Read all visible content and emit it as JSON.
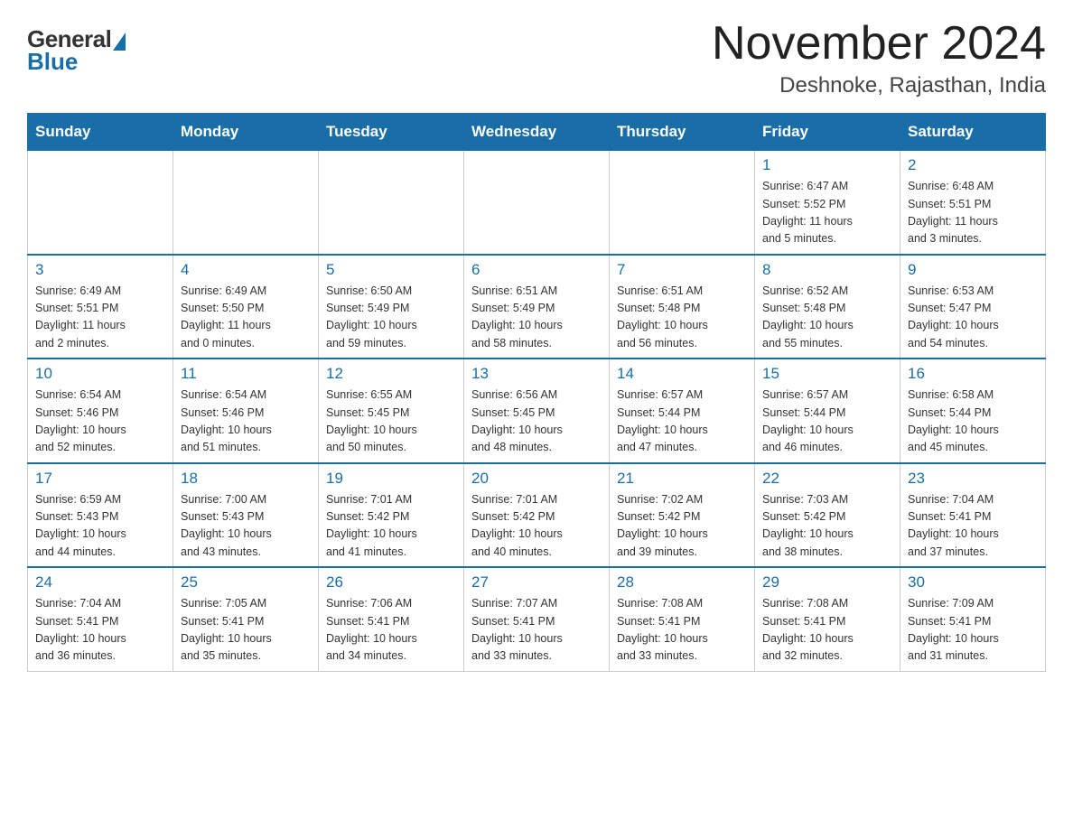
{
  "header": {
    "logo_general": "General",
    "logo_blue": "Blue",
    "month_title": "November 2024",
    "location": "Deshnoke, Rajasthan, India"
  },
  "weekdays": [
    "Sunday",
    "Monday",
    "Tuesday",
    "Wednesday",
    "Thursday",
    "Friday",
    "Saturday"
  ],
  "weeks": [
    [
      {
        "day": "",
        "info": ""
      },
      {
        "day": "",
        "info": ""
      },
      {
        "day": "",
        "info": ""
      },
      {
        "day": "",
        "info": ""
      },
      {
        "day": "",
        "info": ""
      },
      {
        "day": "1",
        "info": "Sunrise: 6:47 AM\nSunset: 5:52 PM\nDaylight: 11 hours\nand 5 minutes."
      },
      {
        "day": "2",
        "info": "Sunrise: 6:48 AM\nSunset: 5:51 PM\nDaylight: 11 hours\nand 3 minutes."
      }
    ],
    [
      {
        "day": "3",
        "info": "Sunrise: 6:49 AM\nSunset: 5:51 PM\nDaylight: 11 hours\nand 2 minutes."
      },
      {
        "day": "4",
        "info": "Sunrise: 6:49 AM\nSunset: 5:50 PM\nDaylight: 11 hours\nand 0 minutes."
      },
      {
        "day": "5",
        "info": "Sunrise: 6:50 AM\nSunset: 5:49 PM\nDaylight: 10 hours\nand 59 minutes."
      },
      {
        "day": "6",
        "info": "Sunrise: 6:51 AM\nSunset: 5:49 PM\nDaylight: 10 hours\nand 58 minutes."
      },
      {
        "day": "7",
        "info": "Sunrise: 6:51 AM\nSunset: 5:48 PM\nDaylight: 10 hours\nand 56 minutes."
      },
      {
        "day": "8",
        "info": "Sunrise: 6:52 AM\nSunset: 5:48 PM\nDaylight: 10 hours\nand 55 minutes."
      },
      {
        "day": "9",
        "info": "Sunrise: 6:53 AM\nSunset: 5:47 PM\nDaylight: 10 hours\nand 54 minutes."
      }
    ],
    [
      {
        "day": "10",
        "info": "Sunrise: 6:54 AM\nSunset: 5:46 PM\nDaylight: 10 hours\nand 52 minutes."
      },
      {
        "day": "11",
        "info": "Sunrise: 6:54 AM\nSunset: 5:46 PM\nDaylight: 10 hours\nand 51 minutes."
      },
      {
        "day": "12",
        "info": "Sunrise: 6:55 AM\nSunset: 5:45 PM\nDaylight: 10 hours\nand 50 minutes."
      },
      {
        "day": "13",
        "info": "Sunrise: 6:56 AM\nSunset: 5:45 PM\nDaylight: 10 hours\nand 48 minutes."
      },
      {
        "day": "14",
        "info": "Sunrise: 6:57 AM\nSunset: 5:44 PM\nDaylight: 10 hours\nand 47 minutes."
      },
      {
        "day": "15",
        "info": "Sunrise: 6:57 AM\nSunset: 5:44 PM\nDaylight: 10 hours\nand 46 minutes."
      },
      {
        "day": "16",
        "info": "Sunrise: 6:58 AM\nSunset: 5:44 PM\nDaylight: 10 hours\nand 45 minutes."
      }
    ],
    [
      {
        "day": "17",
        "info": "Sunrise: 6:59 AM\nSunset: 5:43 PM\nDaylight: 10 hours\nand 44 minutes."
      },
      {
        "day": "18",
        "info": "Sunrise: 7:00 AM\nSunset: 5:43 PM\nDaylight: 10 hours\nand 43 minutes."
      },
      {
        "day": "19",
        "info": "Sunrise: 7:01 AM\nSunset: 5:42 PM\nDaylight: 10 hours\nand 41 minutes."
      },
      {
        "day": "20",
        "info": "Sunrise: 7:01 AM\nSunset: 5:42 PM\nDaylight: 10 hours\nand 40 minutes."
      },
      {
        "day": "21",
        "info": "Sunrise: 7:02 AM\nSunset: 5:42 PM\nDaylight: 10 hours\nand 39 minutes."
      },
      {
        "day": "22",
        "info": "Sunrise: 7:03 AM\nSunset: 5:42 PM\nDaylight: 10 hours\nand 38 minutes."
      },
      {
        "day": "23",
        "info": "Sunrise: 7:04 AM\nSunset: 5:41 PM\nDaylight: 10 hours\nand 37 minutes."
      }
    ],
    [
      {
        "day": "24",
        "info": "Sunrise: 7:04 AM\nSunset: 5:41 PM\nDaylight: 10 hours\nand 36 minutes."
      },
      {
        "day": "25",
        "info": "Sunrise: 7:05 AM\nSunset: 5:41 PM\nDaylight: 10 hours\nand 35 minutes."
      },
      {
        "day": "26",
        "info": "Sunrise: 7:06 AM\nSunset: 5:41 PM\nDaylight: 10 hours\nand 34 minutes."
      },
      {
        "day": "27",
        "info": "Sunrise: 7:07 AM\nSunset: 5:41 PM\nDaylight: 10 hours\nand 33 minutes."
      },
      {
        "day": "28",
        "info": "Sunrise: 7:08 AM\nSunset: 5:41 PM\nDaylight: 10 hours\nand 33 minutes."
      },
      {
        "day": "29",
        "info": "Sunrise: 7:08 AM\nSunset: 5:41 PM\nDaylight: 10 hours\nand 32 minutes."
      },
      {
        "day": "30",
        "info": "Sunrise: 7:09 AM\nSunset: 5:41 PM\nDaylight: 10 hours\nand 31 minutes."
      }
    ]
  ]
}
